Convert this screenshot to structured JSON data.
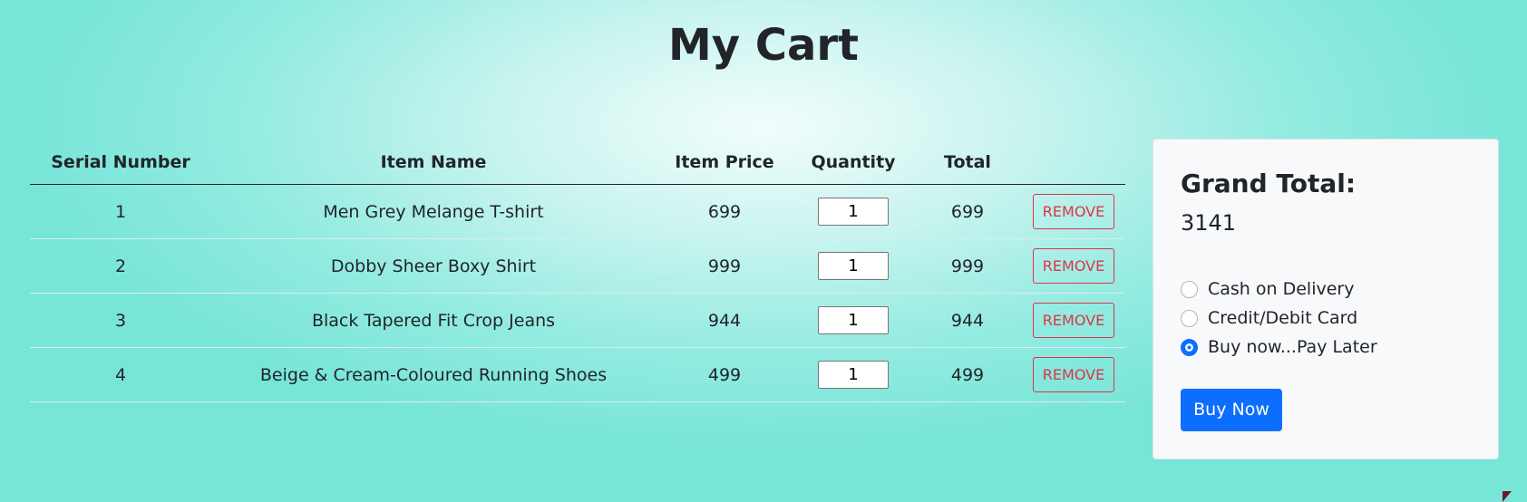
{
  "page": {
    "title": "My Cart"
  },
  "table": {
    "headers": {
      "serial": "Serial Number",
      "name": "Item Name",
      "price": "Item Price",
      "quantity": "Quantity",
      "total": "Total"
    },
    "rows": [
      {
        "serial": "1",
        "name": "Men Grey Melange T-shirt",
        "price": "699",
        "quantity": "1",
        "total": "699",
        "remove_label": "REMOVE"
      },
      {
        "serial": "2",
        "name": "Dobby Sheer Boxy Shirt",
        "price": "999",
        "quantity": "1",
        "total": "999",
        "remove_label": "REMOVE"
      },
      {
        "serial": "3",
        "name": "Black Tapered Fit Crop Jeans",
        "price": "944",
        "quantity": "1",
        "total": "944",
        "remove_label": "REMOVE"
      },
      {
        "serial": "4",
        "name": "Beige & Cream-Coloured Running Shoes",
        "price": "499",
        "quantity": "1",
        "total": "499",
        "remove_label": "REMOVE"
      }
    ]
  },
  "summary": {
    "grand_total_label": "Grand Total:",
    "grand_total_value": "3141",
    "payment_options": [
      {
        "label": "Cash on Delivery",
        "selected": false
      },
      {
        "label": "Credit/Debit Card",
        "selected": false
      },
      {
        "label": "Buy now...Pay Later",
        "selected": true
      }
    ],
    "buy_label": "Buy Now"
  },
  "colors": {
    "primary": "#0d6efd",
    "danger": "#dc3545",
    "background": "#93ebe1"
  }
}
